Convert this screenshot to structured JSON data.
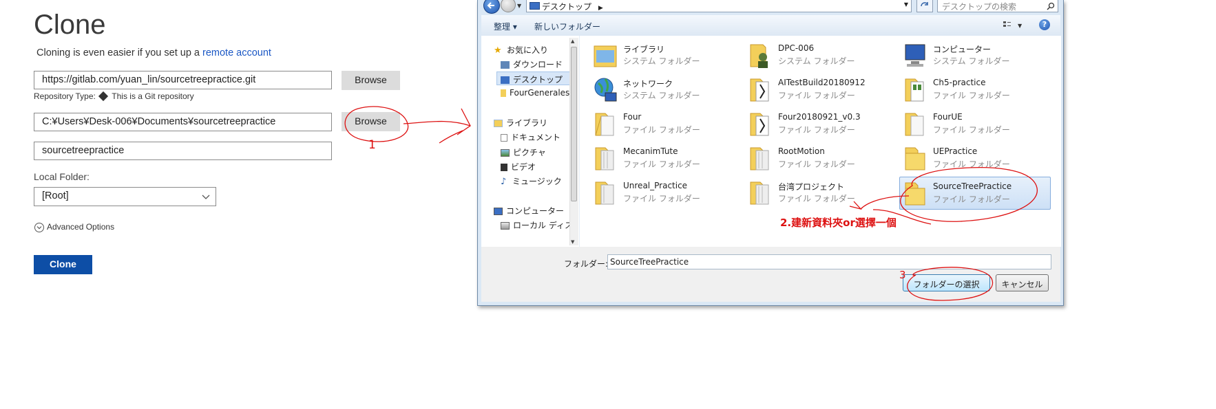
{
  "clone_panel": {
    "title": "Clone",
    "subtitle_prefix": "Cloning is even easier if you set up a ",
    "subtitle_link": "remote account",
    "source_url": "https://gitlab.com/yuan_lin/sourcetreepractice.git",
    "browse_label": "Browse",
    "repo_type_label": "Repository Type:",
    "repo_type_value": "This is a Git repository",
    "destination_path": "C:¥Users¥Desk-006¥Documents¥sourcetreepractice",
    "name_value": "sourcetreepractice",
    "local_folder_label": "Local Folder:",
    "local_folder_value": "[Root]",
    "advanced_options": "Advanced Options",
    "clone_button": "Clone"
  },
  "dialog": {
    "address": "デスクトップ",
    "search_placeholder": "デスクトップの検索",
    "toolbar": {
      "organize": "整理 ▾",
      "new_folder": "新しいフォルダー"
    },
    "nav": [
      "お気に入り",
      "ダウンロード",
      "デスクトップ",
      "FourGenerales",
      "ライブラリ",
      "ドキュメント",
      "ピクチャ",
      "ビデオ",
      "ミュージック",
      "コンピューター",
      "ローカル ディス"
    ],
    "items": [
      {
        "name": "ライブラリ",
        "type": "システム フォルダー"
      },
      {
        "name": "DPC-006",
        "type": "システム フォルダー"
      },
      {
        "name": "コンピューター",
        "type": "システム フォルダー"
      },
      {
        "name": "ネットワーク",
        "type": "システム フォルダー"
      },
      {
        "name": "AITestBuild20180912",
        "type": "ファイル フォルダー"
      },
      {
        "name": "Ch5-practice",
        "type": "ファイル フォルダー"
      },
      {
        "name": "Four",
        "type": "ファイル フォルダー"
      },
      {
        "name": "Four20180921_v0.3",
        "type": "ファイル フォルダー"
      },
      {
        "name": "FourUE",
        "type": "ファイル フォルダー"
      },
      {
        "name": "MecanimTute",
        "type": "ファイル フォルダー"
      },
      {
        "name": "RootMotion",
        "type": "ファイル フォルダー"
      },
      {
        "name": "UEPractice",
        "type": "ファイル フォルダー"
      },
      {
        "name": "Unreal_Practice",
        "type": "ファイル フォルダー"
      },
      {
        "name": "台湾プロジェクト",
        "type": "ファイル フォルダー"
      },
      {
        "name": "SourceTreePractice",
        "type": "ファイル フォルダー"
      }
    ],
    "folder_label": "フォルダー:",
    "folder_value": "SourceTreePractice",
    "select_button": "フォルダーの選択",
    "cancel_button": "キャンセル"
  },
  "annotations": {
    "step1": "1",
    "step2": "2.建新資料夾or選擇一個",
    "step3": "3"
  },
  "colors": {
    "accent": "#0d4ea6",
    "link": "#1a57c4",
    "annotation": "#dd1111",
    "selection": "#cde0f6"
  }
}
